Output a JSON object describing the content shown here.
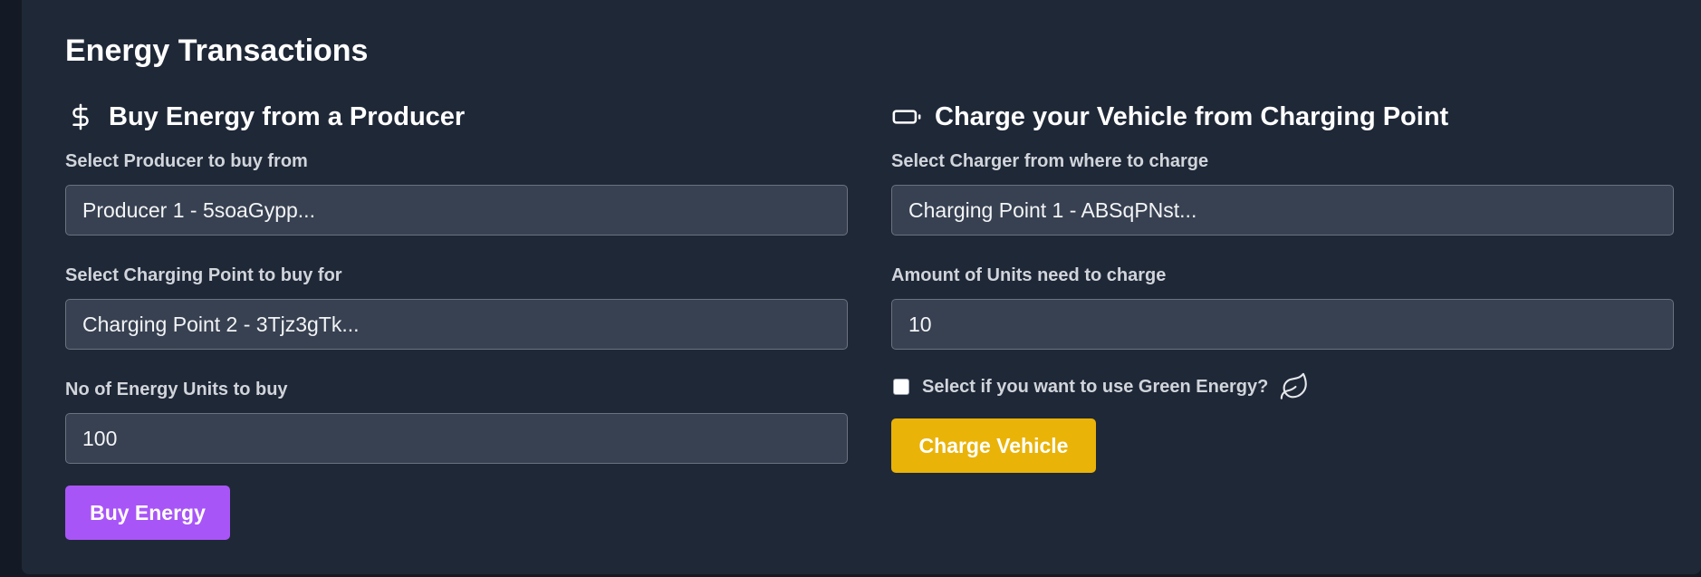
{
  "panel": {
    "title": "Energy Transactions"
  },
  "buy": {
    "heading": "Buy Energy from a Producer",
    "heading_icon": "dollar-icon",
    "producer_label": "Select Producer to buy from",
    "producer_value": "Producer 1 - 5soaGypp...",
    "charging_point_label": "Select Charging Point to buy for",
    "charging_point_value": "Charging Point 2 - 3Tjz3gTk...",
    "units_label": "No of Energy Units to buy",
    "units_value": "100",
    "button_label": "Buy Energy",
    "button_color": "#a855f7"
  },
  "charge": {
    "heading": "Charge your Vehicle from Charging Point",
    "heading_icon": "battery-icon",
    "charger_label": "Select Charger from where to charge",
    "charger_value": "Charging Point 1 - ABSqPNst...",
    "units_label": "Amount of Units need to charge",
    "units_value": "10",
    "green_label": "Select if you want to use Green Energy?",
    "green_checked": false,
    "green_icon": "leaf-icon",
    "button_label": "Charge Vehicle",
    "button_color": "#eab308"
  }
}
